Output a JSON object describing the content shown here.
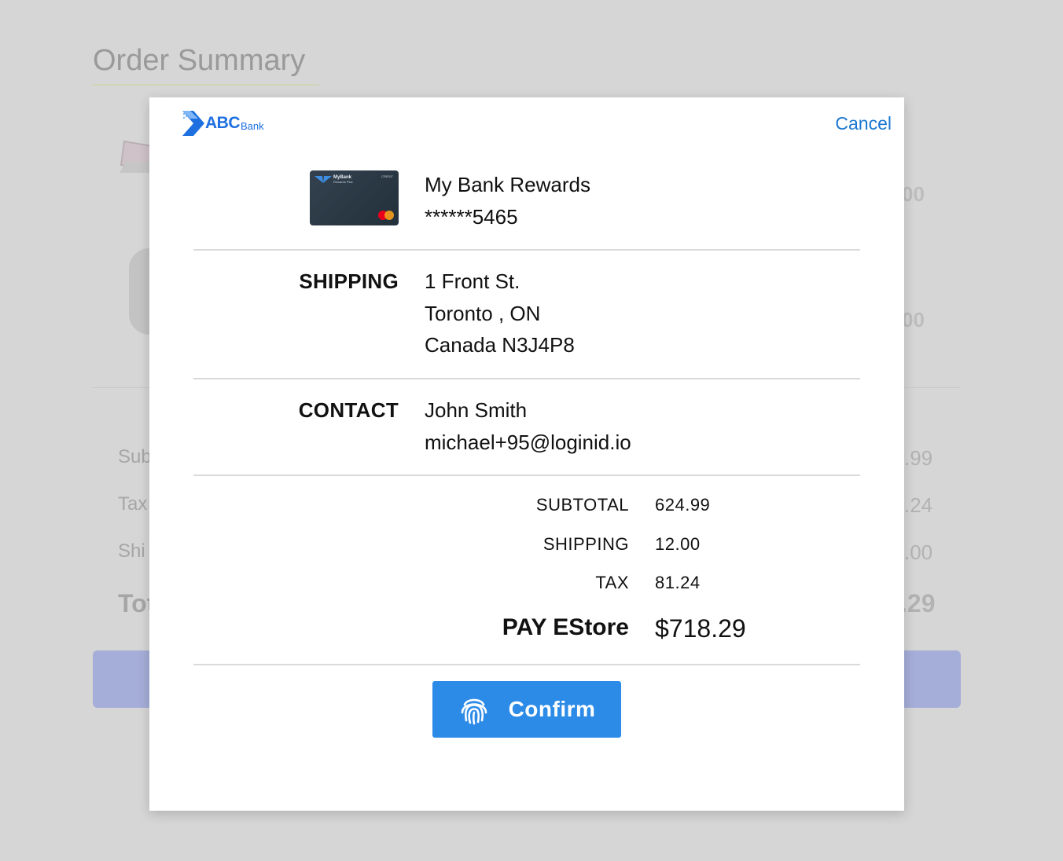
{
  "background": {
    "title": "Order Summary",
    "item_prices": [
      "00",
      "00"
    ],
    "rows": [
      {
        "label": "Sub",
        "value": ".99"
      },
      {
        "label": "Tax",
        "value": ".24"
      },
      {
        "label": "Shi",
        "value": ".00"
      }
    ],
    "total_label": "Tot",
    "total_value": ".29"
  },
  "modal": {
    "logo": {
      "abc": "ABC",
      "bank": "Bank"
    },
    "cancel_label": "Cancel",
    "card": {
      "name": "My Bank Rewards",
      "number": "******5465",
      "image_brand": "MyBank",
      "image_sub": "Rewards Plus",
      "image_credit": "CREDIT"
    },
    "shipping": {
      "label": "SHIPPING",
      "lines": [
        "1 Front St.",
        "Toronto , ON",
        "Canada N3J4P8"
      ]
    },
    "contact": {
      "label": "CONTACT",
      "name": "John Smith",
      "email": "michael+95@loginid.io"
    },
    "summary": {
      "subtotal_label": "SUBTOTAL",
      "subtotal": "624.99",
      "shipping_label": "SHIPPING",
      "shipping": "12.00",
      "tax_label": "TAX",
      "tax": "81.24",
      "pay_label": "PAY EStore",
      "pay_amount": "$718.29"
    },
    "confirm_label": "Confirm",
    "confirm_icon": "fingerprint-icon"
  },
  "colors": {
    "accent": "#2d8be8",
    "link": "#1976d2",
    "brand": "#1e6fe0",
    "overlay": "#d6d6d6"
  }
}
